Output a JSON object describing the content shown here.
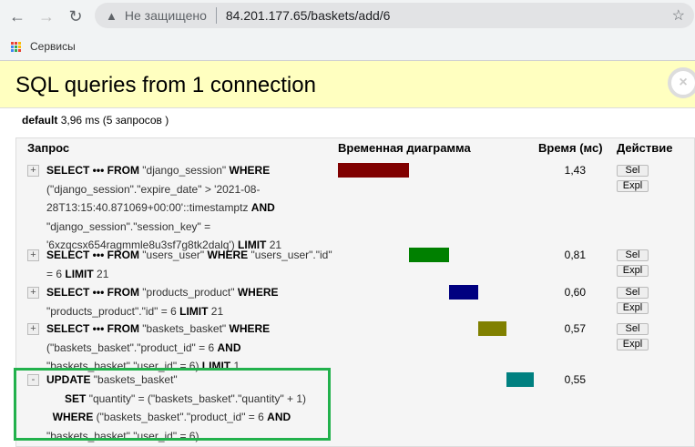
{
  "browser": {
    "security": "Не защищено",
    "url": "84.201.177.65/baskets/add/6",
    "bookmark": "Сервисы"
  },
  "toolbar": {
    "title": "SQL queries from 1 connection",
    "close": "×"
  },
  "summary": {
    "alias": "default",
    "time": "3,96 ms",
    "count": "(5 запросов )"
  },
  "table": {
    "headers": {
      "query": "Запрос",
      "timeline": "Временная диаграмма",
      "time": "Время (мс)",
      "action": "Действие"
    },
    "sel_label": "Sel",
    "expl_label": "Expl",
    "rows": [
      {
        "toggle": "+",
        "time": "1,43",
        "ms": 1.43,
        "color": "#800000",
        "buttons": true,
        "lines": [
          [
            [
              "SELECT ••• FROM",
              1
            ],
            [
              " \"django_session\" ",
              0
            ],
            [
              "WHERE",
              1
            ]
          ],
          [
            [
              "(\"django_session\".\"expire_date\" > '2021-08-",
              0
            ]
          ],
          [
            [
              "28T13:15:40.871069+00:00'::timestamptz ",
              0
            ],
            [
              "AND",
              1
            ]
          ],
          [
            [
              "\"django_session\".\"session_key\" =",
              0
            ]
          ],
          [
            [
              "'6xzqcsx654ragmmle8u3sf7g8tk2dalq') ",
              0
            ],
            [
              "LIMIT",
              1
            ],
            [
              " 21",
              0
            ]
          ]
        ]
      },
      {
        "toggle": "+",
        "time": "0,81",
        "ms": 0.81,
        "color": "#008000",
        "buttons": true,
        "lines": [
          [
            [
              "SELECT ••• FROM",
              1
            ],
            [
              " \"users_user\" ",
              0
            ],
            [
              "WHERE",
              1
            ],
            [
              " \"users_user\".\"id\"",
              0
            ]
          ],
          [
            [
              "= 6 ",
              0
            ],
            [
              "LIMIT",
              1
            ],
            [
              " 21",
              0
            ]
          ]
        ]
      },
      {
        "toggle": "+",
        "time": "0,60",
        "ms": 0.6,
        "color": "#000080",
        "buttons": true,
        "lines": [
          [
            [
              "SELECT ••• FROM",
              1
            ],
            [
              " \"products_product\" ",
              0
            ],
            [
              "WHERE",
              1
            ]
          ],
          [
            [
              "\"products_product\".\"id\" = 6 ",
              0
            ],
            [
              "LIMIT",
              1
            ],
            [
              " 21",
              0
            ]
          ]
        ]
      },
      {
        "toggle": "+",
        "time": "0,57",
        "ms": 0.57,
        "color": "#808000",
        "buttons": true,
        "lines": [
          [
            [
              "SELECT ••• FROM",
              1
            ],
            [
              " \"baskets_basket\" ",
              0
            ],
            [
              "WHERE",
              1
            ]
          ],
          [
            [
              "(\"baskets_basket\".\"product_id\" = 6 ",
              0
            ],
            [
              "AND",
              1
            ]
          ],
          [
            [
              "\"baskets_basket\".\"user_id\" = 6) ",
              0
            ],
            [
              "LIMIT",
              1
            ],
            [
              " 1",
              0
            ]
          ]
        ]
      },
      {
        "toggle": "-",
        "time": "0,55",
        "ms": 0.55,
        "color": "#008080",
        "buttons": false,
        "lines": [
          [
            [
              "UPDATE",
              1
            ],
            [
              " \"baskets_basket\"",
              0
            ]
          ],
          [
            [
              "      ",
              0
            ],
            [
              "SET",
              1
            ],
            [
              " \"quantity\" = (\"baskets_basket\".\"quantity\" + 1)",
              0
            ]
          ],
          [
            [
              "  ",
              0
            ],
            [
              "WHERE",
              1
            ],
            [
              " (\"baskets_basket\".\"product_id\" = 6 ",
              0
            ],
            [
              "AND",
              1
            ]
          ],
          [
            [
              "\"baskets_basket\".\"user_id\" = 6)",
              0
            ]
          ]
        ]
      }
    ]
  }
}
